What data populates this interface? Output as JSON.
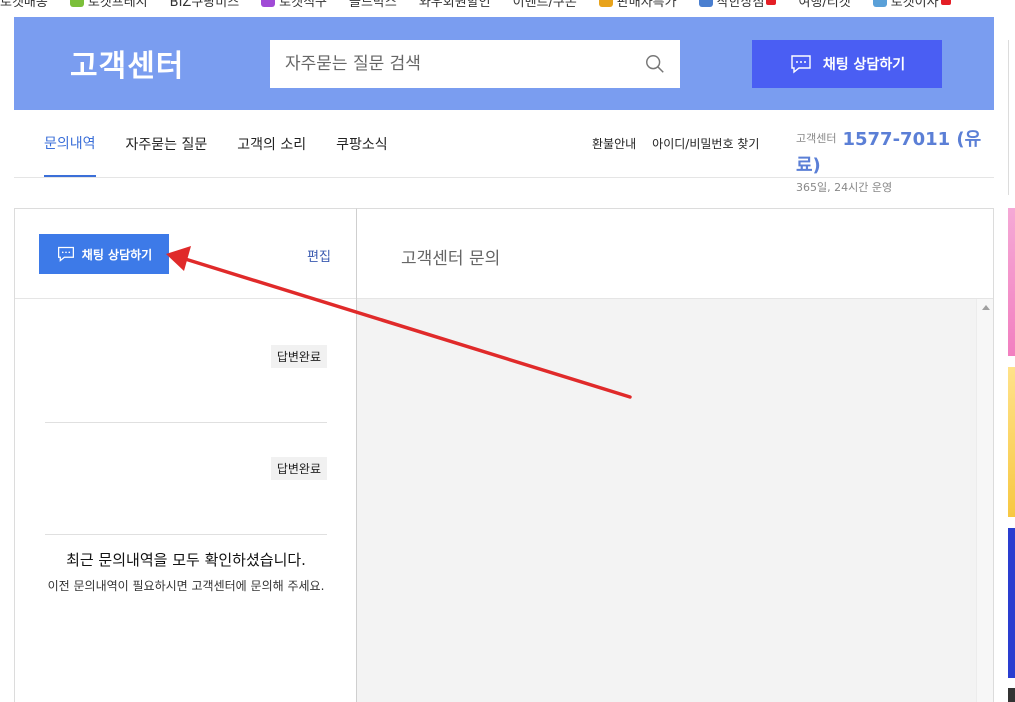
{
  "top_nav": {
    "items": [
      {
        "label": "로켓배송",
        "icon_color": "",
        "badge": false
      },
      {
        "label": "로켓프레시",
        "icon_color": "#7bbf3a",
        "badge": false
      },
      {
        "label": "BIZ쿠팡비즈",
        "icon_color": "",
        "badge": false
      },
      {
        "label": "로켓직구",
        "icon_color": "#a04ad6",
        "badge": false
      },
      {
        "label": "골드박스",
        "icon_color": "",
        "badge": false
      },
      {
        "label": "와우회원할인",
        "icon_color": "",
        "badge": false
      },
      {
        "label": "이벤트/쿠폰",
        "icon_color": "",
        "badge": false
      },
      {
        "label": "판매자특가",
        "icon_color": "#e8a31b",
        "badge": false
      },
      {
        "label": "착한상점",
        "icon_color": "#4a7fd0",
        "badge": true
      },
      {
        "label": "여행/티켓",
        "icon_color": "",
        "badge": false
      },
      {
        "label": "로켓이사",
        "icon_color": "#5aa0d8",
        "badge": true
      }
    ]
  },
  "header": {
    "logo": "고객센터",
    "search_placeholder": "자주묻는 질문 검색",
    "chat_button": "채팅 상담하기"
  },
  "subnav": {
    "tabs": [
      "문의내역",
      "자주묻는 질문",
      "고객의 소리",
      "쿠팡소식"
    ],
    "active_tab": 0,
    "links": [
      "환불안내",
      "아이디/비밀번호 찾기"
    ],
    "cs_label": "고객센터",
    "cs_number": "1577-7011 (유료)",
    "cs_hours": "365일, 24시간 운영"
  },
  "left_panel": {
    "chat_button": "채팅 상담하기",
    "edit": "편집",
    "inquiries": [
      {
        "status": "답변완료"
      },
      {
        "status": "답변완료"
      }
    ],
    "notice_title": "최근 문의내역을 모두 확인하셨습니다.",
    "notice_desc": "이전 문의내역이 필요하시면 고객센터에 문의해 주세요."
  },
  "right_panel": {
    "title": "고객센터 문의"
  },
  "colors": {
    "header_bg": "#7a9df0",
    "header_chat_bg": "#4a5ef3",
    "chat_btn_bg": "#3d7ae8",
    "active_tab": "#3b6fd8",
    "arrow": "#e02a2a"
  }
}
